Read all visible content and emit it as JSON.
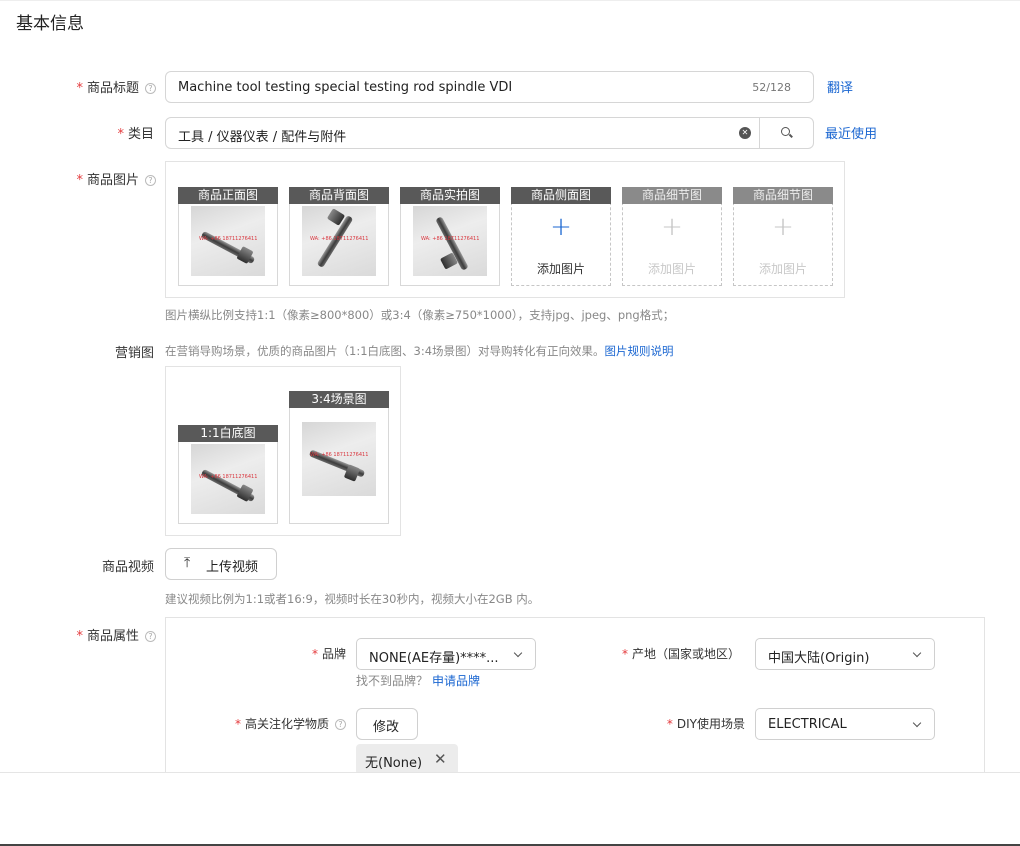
{
  "section": {
    "title": "基本信息"
  },
  "title_field": {
    "label": "商品标题",
    "value": "Machine tool testing special testing rod spindle VDI",
    "counter": "52/128",
    "translate_link": "翻译"
  },
  "category_field": {
    "label": "类目",
    "value": "工具 / 仪器仪表 / 配件与附件",
    "recent_link": "最近使用"
  },
  "images_field": {
    "label": "商品图片",
    "slots": [
      {
        "head": "商品正面图",
        "filled": true
      },
      {
        "head": "商品背面图",
        "filled": true
      },
      {
        "head": "商品实拍图",
        "filled": true
      },
      {
        "head": "商品侧面图",
        "filled": false,
        "add_label": "添加图片"
      },
      {
        "head": "商品细节图",
        "filled": false,
        "add_label": "添加图片"
      },
      {
        "head": "商品细节图",
        "filled": false,
        "add_label": "添加图片"
      }
    ],
    "watermark": "WA: +86 18711276411",
    "hint": "图片横纵比例支持1:1（像素≥800*800）或3:4（像素≥750*1000），支持jpg、jpeg、png格式；"
  },
  "marketing_field": {
    "label": "营销图",
    "hint": "在营销导购场景，优质的商品图片（1:1白底图、3:4场景图）对导购转化有正向效果。",
    "rules_link": "图片规则说明",
    "slots": [
      {
        "head": "1:1白底图"
      },
      {
        "head": "3:4场景图"
      }
    ]
  },
  "video_field": {
    "label": "商品视频",
    "upload_button": "上传视频",
    "hint": "建议视频比例为1:1或者16:9，视频时长在30秒内，视频大小在2GB 内。"
  },
  "attributes_field": {
    "label": "商品属性",
    "brand": {
      "label": "品牌",
      "value": "NONE(AE存量)****...",
      "not_found": "找不到品牌？",
      "apply_link": "申请品牌"
    },
    "origin": {
      "label": "产地（国家或地区）",
      "value": "中国大陆(Origin)"
    },
    "chemicals": {
      "label": "高关注化学物质",
      "edit_button": "修改",
      "tag": "无(None)"
    },
    "diy": {
      "label": "DIY使用场景",
      "value": "ELECTRICAL"
    }
  },
  "colors": {
    "accent": "#1a66d1",
    "required": "#e4393c",
    "slot_header": "#595959"
  }
}
